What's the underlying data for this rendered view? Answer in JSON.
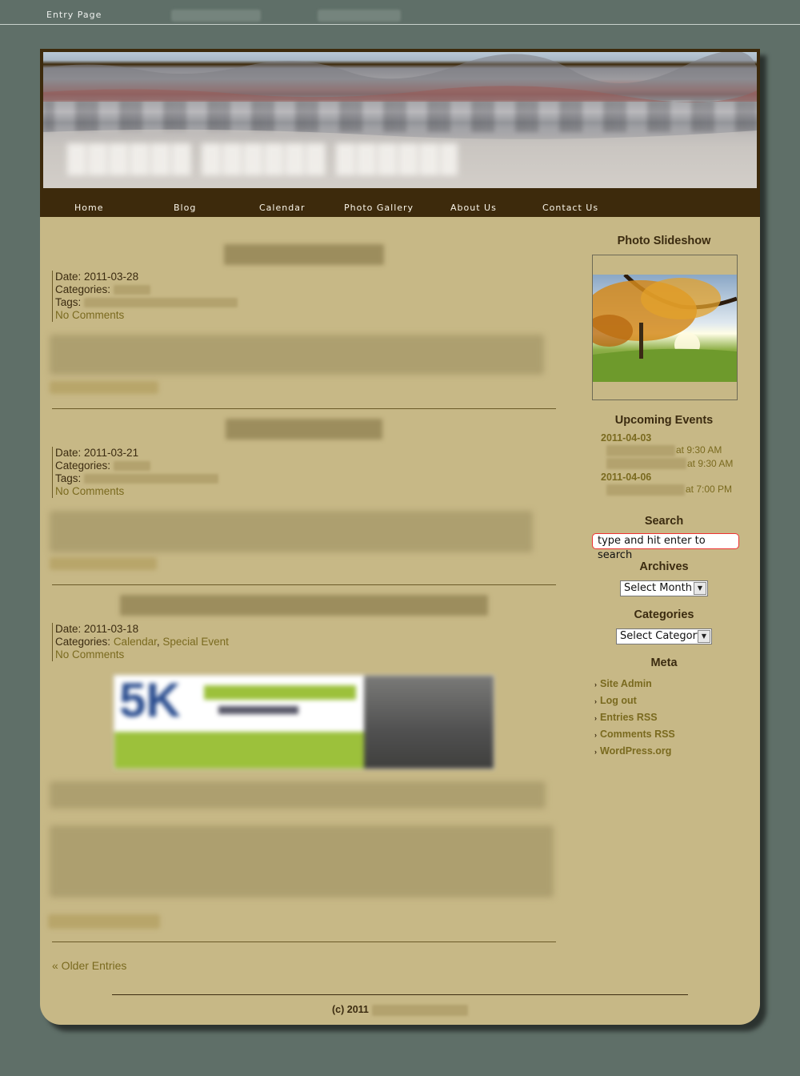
{
  "topbar": {
    "entry_label": "Entry Page"
  },
  "nav": {
    "items": [
      "Home",
      "Blog",
      "Calendar",
      "Photo Gallery",
      "About Us",
      "Contact Us"
    ]
  },
  "posts": [
    {
      "date": "Date: 2011-03-28",
      "categories_label": "Categories:",
      "tags_label": "Tags:",
      "comments": "No Comments"
    },
    {
      "date": "Date: 2011-03-21",
      "categories_label": "Categories:",
      "tags_label": "Tags:",
      "comments": "No Comments"
    },
    {
      "date": "Date: 2011-03-18",
      "categories_label": "Categories:",
      "categories": [
        "Calendar",
        "Special Event"
      ],
      "comments": "No Comments",
      "image_text": "5K"
    }
  ],
  "older_entries": "« Older Entries",
  "sidebar": {
    "slideshow_title": "Photo Slideshow",
    "events_title": "Upcoming Events",
    "events": [
      {
        "date": "2011-04-03",
        "times": [
          "at 9:30 AM",
          "at 9:30 AM"
        ]
      },
      {
        "date": "2011-04-06",
        "times": [
          "at 7:00 PM"
        ]
      }
    ],
    "search_title": "Search",
    "search_placeholder": "type and hit enter to search",
    "archives_title": "Archives",
    "archives_select": "Select Month",
    "categories_title": "Categories",
    "categories_select": "Select Category",
    "meta_title": "Meta",
    "meta_links": [
      "Site Admin",
      "Log out",
      "Entries RSS",
      "Comments RSS",
      "WordPress.org"
    ]
  },
  "footer": {
    "copyright": "(c) 2011"
  }
}
